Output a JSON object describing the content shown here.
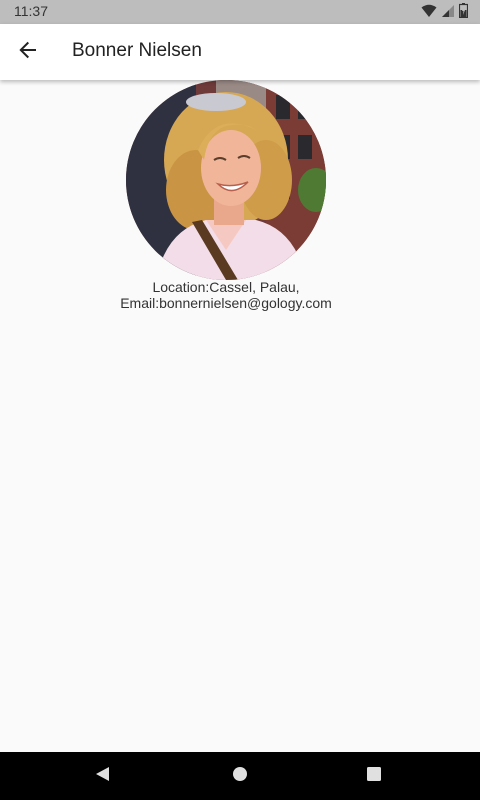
{
  "status_bar": {
    "time": "11:37",
    "icons": [
      "wifi-icon",
      "cell-signal-icon",
      "battery-icon"
    ]
  },
  "app_bar": {
    "title": "Bonner Nielsen",
    "back_icon": "arrow-back-icon"
  },
  "profile": {
    "photo": "profile-photo",
    "location_line": "Location:Cassel, Palau,",
    "email_line": "Email:bonnernielsen@gology.com"
  },
  "nav_bar": {
    "buttons": [
      "nav-back-icon",
      "nav-home-icon",
      "nav-recents-icon"
    ]
  },
  "colors": {
    "status_bar": "#bdbdbd",
    "app_bar": "#ffffff",
    "background": "#fafafa",
    "nav_bar": "#000000"
  }
}
